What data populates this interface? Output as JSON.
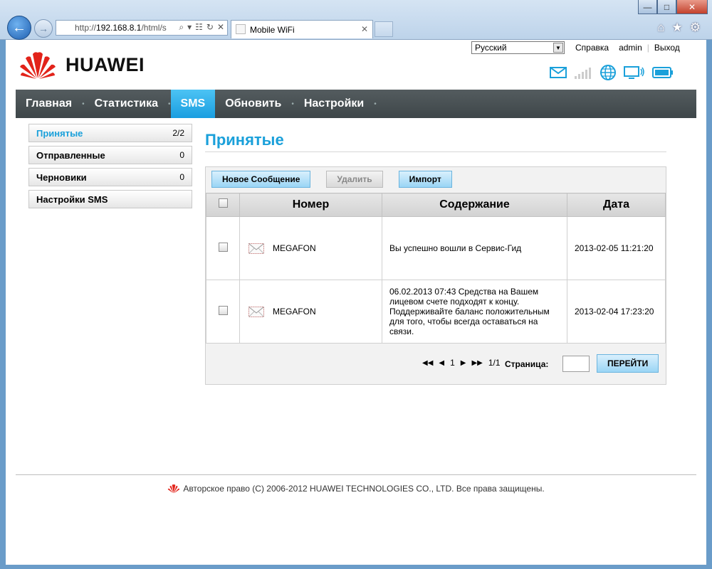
{
  "browser": {
    "url_prefix": "http://",
    "url_host": "192.168.8.1",
    "url_rest": "/html/s",
    "tab_title": "Mobile WiFi",
    "tab_close": "✕",
    "window_controls": [
      "—",
      "□",
      "✕"
    ]
  },
  "header": {
    "language": "Русский",
    "help_link": "Справка",
    "user": "admin",
    "logout": "Выход",
    "logo_text": "HUAWEI"
  },
  "nav": {
    "items": [
      {
        "label": "Главная",
        "active": false
      },
      {
        "label": "Статистика",
        "active": false
      },
      {
        "label": "SMS",
        "active": true
      },
      {
        "label": "Обновить",
        "active": false
      },
      {
        "label": "Настройки",
        "active": false
      }
    ]
  },
  "sidebar": {
    "items": [
      {
        "label": "Принятые",
        "count": "2/2",
        "active": true
      },
      {
        "label": "Отправленные",
        "count": "0",
        "active": false
      },
      {
        "label": "Черновики",
        "count": "0",
        "active": false
      },
      {
        "label": "Настройки SMS",
        "count": "",
        "active": false
      }
    ]
  },
  "main": {
    "title": "Принятые",
    "toolbar": {
      "new_message": "Новое Сообщение",
      "delete": "Удалить",
      "import": "Импорт"
    },
    "table": {
      "headers": {
        "number": "Номер",
        "content": "Содержание",
        "date": "Дата"
      },
      "rows": [
        {
          "number": "MEGAFON",
          "content": "Вы успешно вошли в Сервис-Гид",
          "date": "2013-02-05 11:21:20"
        },
        {
          "number": "MEGAFON",
          "content": "06.02.2013 07:43 Средства на Вашем лицевом счете подходят к концу. Поддерживайте баланс положительным для того, чтобы всегда оставаться на связи.",
          "date": "2013-02-04 17:23:20"
        }
      ]
    },
    "pager": {
      "current_page": "1",
      "of": "1/1",
      "page_label": "Страница:",
      "go_button": "ПЕРЕЙТИ"
    }
  },
  "footer": {
    "copyright": "Авторское право (C) 2006-2012 HUAWEI TECHNOLOGIES CO., LTD. Все права защищены."
  },
  "colors": {
    "accent": "#1aa0da",
    "nav_bg": "#474f52",
    "brand_red": "#e2231a"
  }
}
